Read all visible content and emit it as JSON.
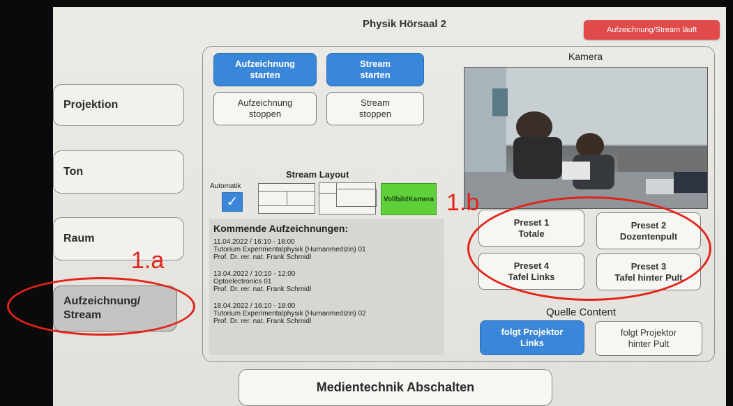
{
  "header": {
    "title": "Physik Hörsaal 2",
    "status": "Aufzeichnung/Stream läuft"
  },
  "nav": [
    {
      "label": "Projektion"
    },
    {
      "label": "Ton"
    },
    {
      "label": "Raum"
    },
    {
      "label_line1": "Aufzeichnung/",
      "label_line2": "Stream"
    }
  ],
  "controls": {
    "rec_start": {
      "line1": "Aufzeichnung",
      "line2": "starten"
    },
    "stream_start": {
      "line1": "Stream",
      "line2": "starten"
    },
    "rec_stop": {
      "line1": "Aufzeichnung",
      "line2": "stoppen"
    },
    "stream_stop": {
      "line1": "Stream",
      "line2": "stoppen"
    }
  },
  "layout": {
    "title": "Stream Layout",
    "auto_label": "Automatik",
    "fullscreen": {
      "line1": "Vollbild",
      "line2": "Kamera"
    }
  },
  "upcoming": {
    "title": "Kommende Aufzeichnungen:",
    "items": [
      {
        "date": "11.04.2022 / 16:10 - 18:00",
        "course": "Tutorium Experimentalphysik (Humanmedizin) 01",
        "lecturer": "Prof. Dr. rer. nat. Frank Schmidl"
      },
      {
        "date": "13.04.2022 / 10:10 - 12:00",
        "course": "Optoelectronics 01",
        "lecturer": "Prof. Dr. rer. nat. Frank Schmidl"
      },
      {
        "date": "18.04.2022 / 16:10 - 18:00",
        "course": "Tutorium Experimentalphysik (Humanmedizin) 02",
        "lecturer": "Prof. Dr. rer. nat. Frank Schmidl"
      }
    ]
  },
  "camera": {
    "title": "Kamera",
    "presets": [
      {
        "line1": "Preset  1",
        "line2": "Totale"
      },
      {
        "line1": "Preset  2",
        "line2": "Dozentenpult"
      },
      {
        "line1": "Preset  4",
        "line2": "Tafel Links"
      },
      {
        "line1": "Preset  3",
        "line2": "Tafel hinter Pult"
      }
    ]
  },
  "content_source": {
    "title": "Quelle Content",
    "left": {
      "line1": "folgt Projektor",
      "line2": "Links"
    },
    "right": {
      "line1": "folgt Projektor",
      "line2": "hinter Pult"
    }
  },
  "footer": {
    "shutdown": "Medientechnik Abschalten"
  },
  "annotations": {
    "a": "1.a",
    "b": "1.b"
  },
  "colors": {
    "accent": "#3a86d8",
    "status_red": "#e04a4a",
    "fullscreen_green": "#5fcf3a",
    "annotation_red": "#e3231a"
  }
}
